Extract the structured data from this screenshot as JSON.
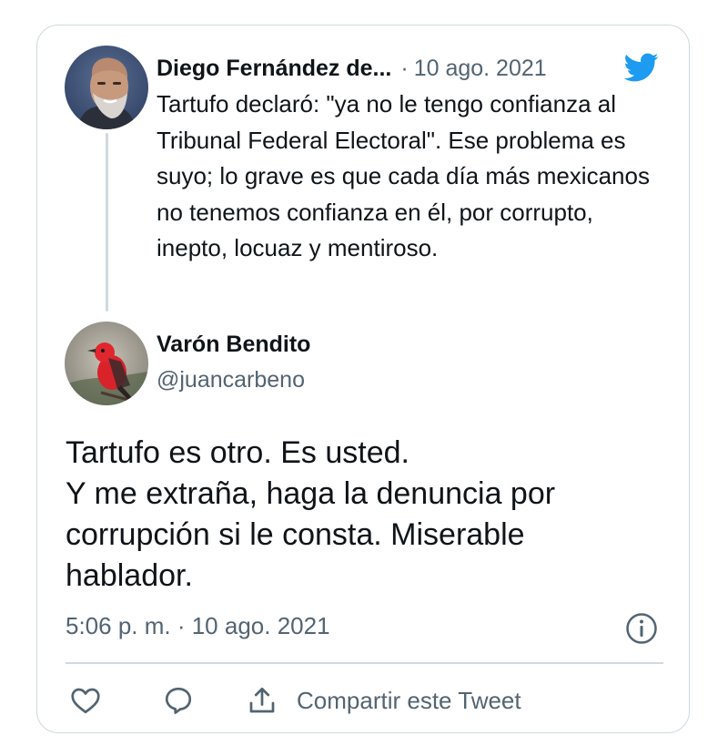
{
  "quoted_tweet": {
    "author_name": "Diego Fernández de...",
    "separator": "·",
    "date": "10 ago. 2021",
    "avatar_icon": "avatar-photo-icon",
    "text": "Tartufo declaró: \"ya no le tengo confianza al Tribunal Federal Electoral\". Ese problema es suyo; lo grave es que cada día más mexicanos no tenemos confianza en él, por corrupto, inepto, locuaz y mentiroso."
  },
  "brand": {
    "icon": "twitter-bird-icon",
    "color": "#1d9bf0"
  },
  "reply_tweet": {
    "author_name": "Varón Bendito",
    "handle": "@juancarbeno",
    "avatar_icon": "red-bird-avatar-icon",
    "text_lines": [
      "Tartufo es otro. Es usted.",
      "Y me extraña, haga la denuncia por",
      "corrupción si le consta. Miserable",
      "hablador."
    ],
    "timestamp": "5:06 p. m. · 10 ago. 2021"
  },
  "actions": {
    "like_icon": "heart-icon",
    "reply_icon": "reply-bubble-icon",
    "share_icon": "share-icon",
    "share_label": "Compartir este Tweet",
    "info_icon": "info-icon"
  },
  "colors": {
    "text_primary": "#0f1419",
    "text_secondary": "#536471",
    "border": "#cfd9de",
    "avatar_bird_red": "#d8232a"
  }
}
